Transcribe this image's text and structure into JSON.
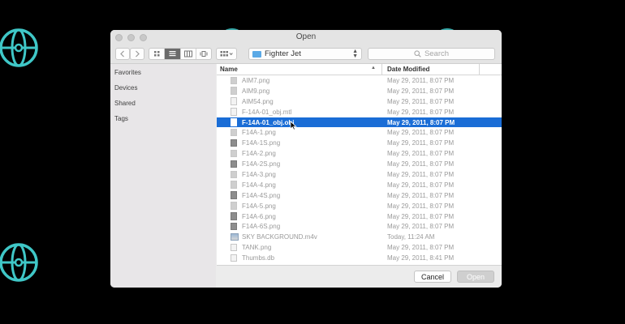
{
  "window": {
    "title": "Open"
  },
  "toolbar": {
    "back_icon": "chevron-left-icon",
    "forward_icon": "chevron-right-icon",
    "view_modes": [
      "icon-view-icon",
      "list-view-icon",
      "column-view-icon",
      "cover-flow-icon"
    ],
    "active_view": "list-view-icon",
    "arrange_icon": "arrange-grid-icon",
    "location": "Fighter Jet",
    "search_placeholder": "Search"
  },
  "sidebar": {
    "items": [
      "Favorites",
      "Devices",
      "Shared",
      "Tags"
    ]
  },
  "columns": {
    "name": "Name",
    "date": "Date Modified"
  },
  "files": [
    {
      "name": "AIM7.png",
      "date": "May 29, 2011, 8:07 PM"
    },
    {
      "name": "AIM9.png",
      "date": "May 29, 2011, 8:07 PM"
    },
    {
      "name": "AIM54.png",
      "date": "May 29, 2011, 8:07 PM"
    },
    {
      "name": "F-14A-01_obj.mtl",
      "date": "May 29, 2011, 8:07 PM"
    },
    {
      "name": "F-14A-01_obj.obj",
      "date": "May 29, 2011, 8:07 PM"
    },
    {
      "name": "F14A-1.png",
      "date": "May 29, 2011, 8:07 PM"
    },
    {
      "name": "F14A-1S.png",
      "date": "May 29, 2011, 8:07 PM"
    },
    {
      "name": "F14A-2.png",
      "date": "May 29, 2011, 8:07 PM"
    },
    {
      "name": "F14A-2S.png",
      "date": "May 29, 2011, 8:07 PM"
    },
    {
      "name": "F14A-3.png",
      "date": "May 29, 2011, 8:07 PM"
    },
    {
      "name": "F14A-4.png",
      "date": "May 29, 2011, 8:07 PM"
    },
    {
      "name": "F14A-4S.png",
      "date": "May 29, 2011, 8:07 PM"
    },
    {
      "name": "F14A-5.png",
      "date": "May 29, 2011, 8:07 PM"
    },
    {
      "name": "F14A-6.png",
      "date": "May 29, 2011, 8:07 PM"
    },
    {
      "name": "F14A-6S.png",
      "date": "May 29, 2011, 8:07 PM"
    },
    {
      "name": "SKY BACKGROUND.m4v",
      "date": "Today, 11:24 AM"
    },
    {
      "name": "TANK.png",
      "date": "May 29, 2011, 8:07 PM"
    },
    {
      "name": "Thumbs.db",
      "date": "May 29, 2011, 8:41 PM"
    }
  ],
  "selected_file": "F-14A-01_obj.obj",
  "buttons": {
    "cancel": "Cancel",
    "open": "Open"
  },
  "colors": {
    "selection": "#1a6dd6",
    "background_icon": "#3fc7c7"
  }
}
